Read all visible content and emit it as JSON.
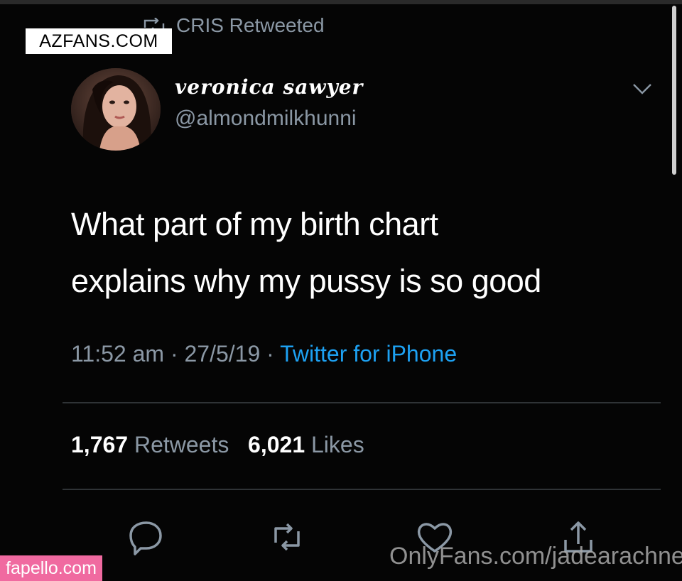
{
  "retweet_header": {
    "text": "CRIS Retweeted"
  },
  "watermarks": {
    "top_left": "AZFANS.COM",
    "bottom_right": "OnlyFans.com/jadearachne",
    "bottom_left": "fapello.com"
  },
  "author": {
    "display_name": "veronica sawyer",
    "handle": "@almondmilkhunni"
  },
  "tweet": {
    "line1": "What part of my birth chart",
    "line2": "explains why my pussy is so good"
  },
  "meta": {
    "time": "11:52 am",
    "sep1": " · ",
    "date": "27/5/19",
    "sep2": " · ",
    "source": "Twitter for iPhone"
  },
  "stats": {
    "retweets_count": "1,767",
    "retweets_label": "Retweets",
    "likes_count": "6,021",
    "likes_label": "Likes"
  },
  "colors": {
    "background": "#000000",
    "text": "#ffffff",
    "secondary": "#8b98a5",
    "link": "#1da1f2"
  },
  "icons": [
    "retweet-small-icon",
    "chevron-down-icon",
    "reply-icon",
    "retweet-icon",
    "like-icon",
    "share-icon"
  ]
}
